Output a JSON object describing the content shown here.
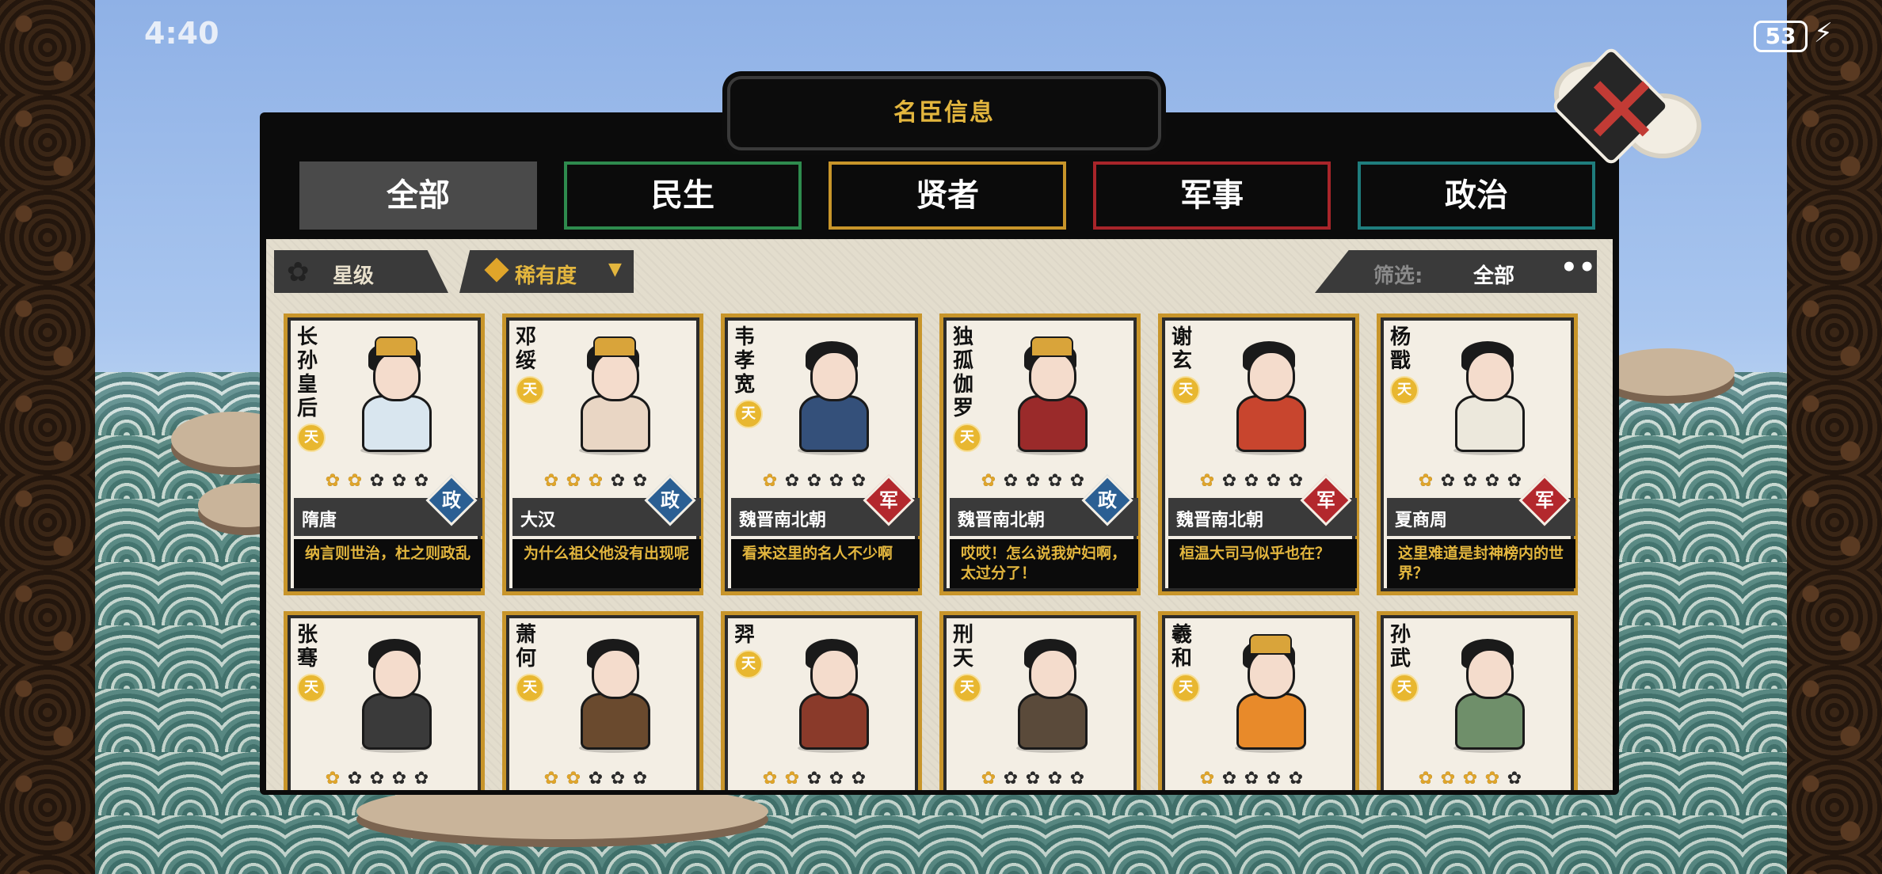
{
  "status": {
    "time": "4:40",
    "battery": "53"
  },
  "panel": {
    "title": "名臣信息"
  },
  "tabs": [
    {
      "label": "全部",
      "color": "#4a4a4a",
      "active": true
    },
    {
      "label": "民生",
      "color": "#2e8b4e",
      "active": false
    },
    {
      "label": "贤者",
      "color": "#c8952a",
      "active": false
    },
    {
      "label": "军事",
      "color": "#a8252a",
      "active": false
    },
    {
      "label": "政治",
      "color": "#1f7d7d",
      "active": false
    }
  ],
  "toolbar": {
    "sort_star_label": "星级",
    "sort_rarity_label": "稀有度",
    "filter_key": "筛选:",
    "filter_value": "全部",
    "more": "•••"
  },
  "badge_colors": {
    "政": "#2b5f93",
    "军": "#b3282d"
  },
  "cards": [
    {
      "name": "长孙皇后",
      "grade": "天",
      "stars_on": 2,
      "dynasty": "隋唐",
      "type": "政",
      "quote": "纳言则世治，杜之则政乱",
      "body_color": "#d9e6ef",
      "crown": true
    },
    {
      "name": "邓绥",
      "grade": "天",
      "stars_on": 3,
      "dynasty": "大汉",
      "type": "政",
      "quote": "为什么祖父他没有出现呢",
      "body_color": "#e9d6c4",
      "crown": true
    },
    {
      "name": "韦孝宽",
      "grade": "天",
      "stars_on": 1,
      "dynasty": "魏晋南北朝",
      "type": "军",
      "quote": "看来这里的名人不少啊",
      "body_color": "#34507a",
      "crown": false
    },
    {
      "name": "独孤伽罗",
      "grade": "天",
      "stars_on": 1,
      "dynasty": "魏晋南北朝",
      "type": "政",
      "quote": "哎哎！怎么说我妒妇啊，太过分了！",
      "body_color": "#9a2a2a",
      "crown": true
    },
    {
      "name": "谢玄",
      "grade": "天",
      "stars_on": 1,
      "dynasty": "魏晋南北朝",
      "type": "军",
      "quote": "桓温大司马似乎也在？",
      "body_color": "#c8452e",
      "crown": false
    },
    {
      "name": "杨戬",
      "grade": "天",
      "stars_on": 1,
      "dynasty": "夏商周",
      "type": "军",
      "quote": "这里难道是封神榜内的世界？",
      "body_color": "#ece8dc",
      "crown": false
    },
    {
      "name": "张骞",
      "grade": "天",
      "stars_on": 1,
      "dynasty": "",
      "type": "",
      "quote": "",
      "body_color": "#3a3a3a",
      "crown": false
    },
    {
      "name": "萧何",
      "grade": "天",
      "stars_on": 2,
      "dynasty": "",
      "type": "",
      "quote": "",
      "body_color": "#6a4a2e",
      "crown": false
    },
    {
      "name": "羿",
      "grade": "天",
      "stars_on": 2,
      "dynasty": "",
      "type": "",
      "quote": "",
      "body_color": "#8a3a2a",
      "crown": false
    },
    {
      "name": "刑天",
      "grade": "天",
      "stars_on": 1,
      "dynasty": "",
      "type": "",
      "quote": "",
      "body_color": "#5a4a3a",
      "crown": false
    },
    {
      "name": "羲和",
      "grade": "天",
      "stars_on": 1,
      "dynasty": "",
      "type": "",
      "quote": "",
      "body_color": "#e88a2a",
      "crown": true
    },
    {
      "name": "孙武",
      "grade": "天",
      "stars_on": 4,
      "dynasty": "",
      "type": "",
      "quote": "",
      "body_color": "#6f8f6a",
      "crown": false
    }
  ]
}
